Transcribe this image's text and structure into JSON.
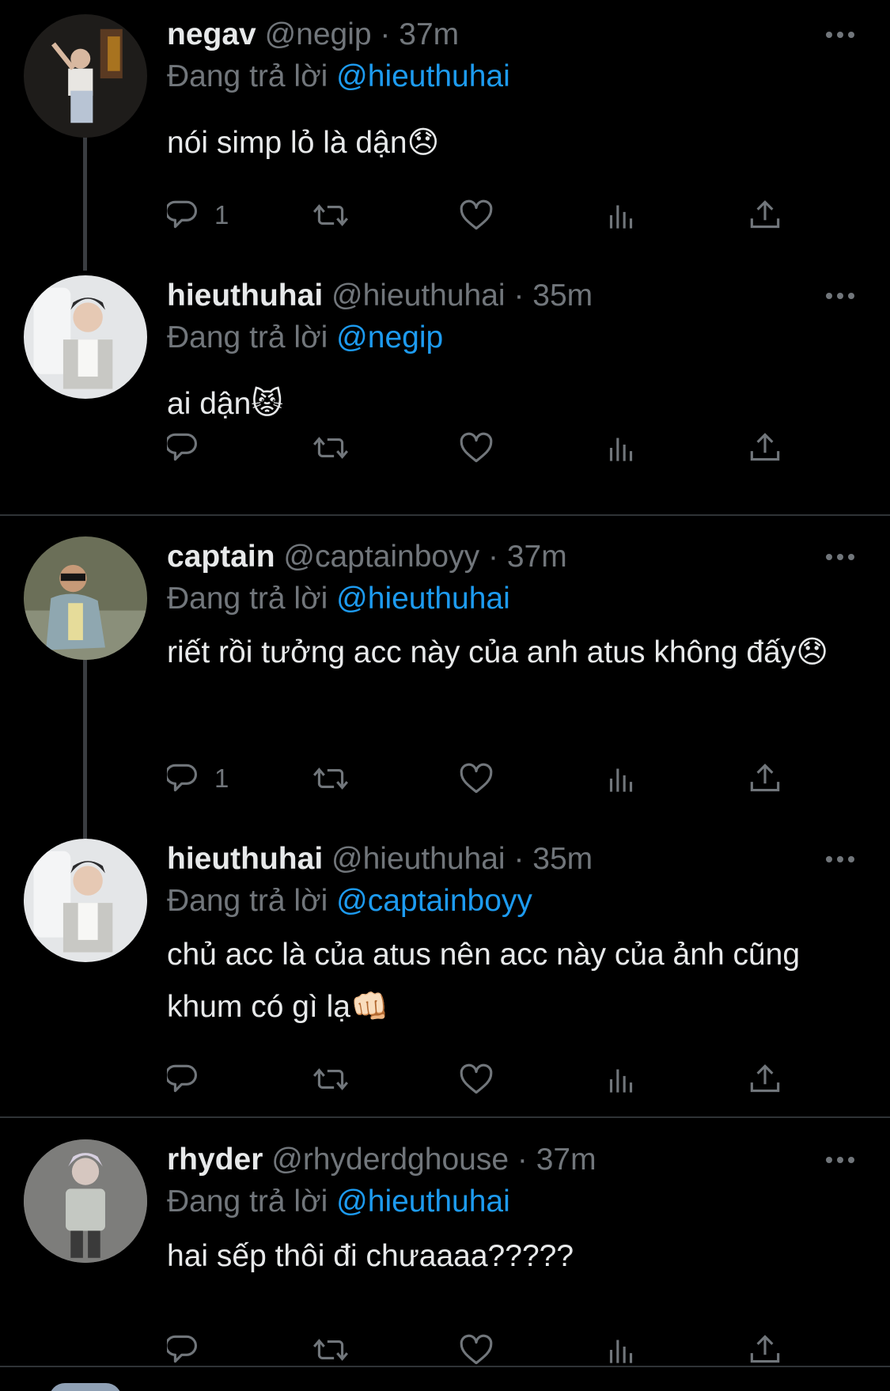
{
  "reply_label": "Đang trả lời",
  "colors": {
    "background": "#000000",
    "text": "#e7e9ea",
    "muted": "#71767b",
    "accent": "#1d9bf0",
    "divider": "#2f3336"
  },
  "icons": [
    "reply-icon",
    "retweet-icon",
    "like-icon",
    "views-icon",
    "share-icon",
    "more-icon"
  ],
  "tweets": [
    {
      "name": "negav",
      "handle": "@negip",
      "separator": "·",
      "time": "37m",
      "replying_to": "@hieuthuhai",
      "text": "nói simp lỏ là dận😞",
      "reply_count": "1"
    },
    {
      "name": "hieuthuhai",
      "handle": "@hieuthuhai",
      "separator": "·",
      "time": "35m",
      "replying_to": "@negip",
      "text": "ai dận😾",
      "reply_count": ""
    },
    {
      "name": "captain",
      "handle": "@captainboyy",
      "separator": "·",
      "time": "37m",
      "replying_to": "@hieuthuhai",
      "text": "riết rồi tưởng acc này của anh atus không đấy😞",
      "reply_count": "1"
    },
    {
      "name": "hieuthuhai",
      "handle": "@hieuthuhai",
      "separator": "·",
      "time": "35m",
      "replying_to": "@captainboyy",
      "text": "chủ acc là của atus nên acc này của ảnh cũng khum có gì lạ👊🏻",
      "reply_count": ""
    },
    {
      "name": "rhyder",
      "handle": "@rhyderdghouse",
      "separator": "·",
      "time": "37m",
      "replying_to": "@hieuthuhai",
      "text": "hai sếp thôi đi chưaaaa?????",
      "reply_count": ""
    }
  ]
}
